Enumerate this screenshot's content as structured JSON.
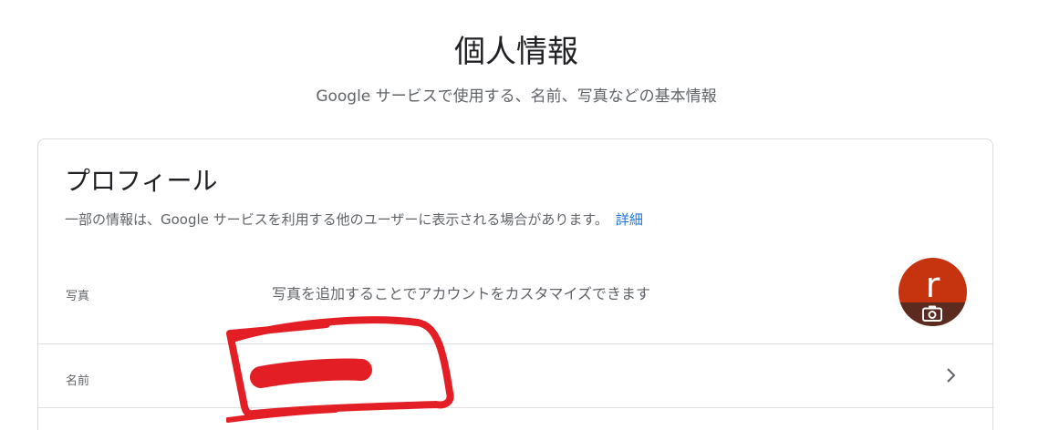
{
  "header": {
    "title": "個人情報",
    "subtitle": "Google サービスで使用する、名前、写真などの基本情報"
  },
  "profile_card": {
    "title": "プロフィール",
    "description": "一部の情報は、Google サービスを利用する他のユーザーに表示される場合があります。",
    "details_link": "詳細",
    "photo_row": {
      "label": "写真",
      "value": "写真を追加することでアカウントをカスタマイズできます",
      "avatar_letter": "r",
      "avatar_color": "#c6330f",
      "camera_icon": "camera-icon"
    },
    "name_row": {
      "label": "名前",
      "value": "",
      "chevron_icon": "chevron-right-icon"
    }
  },
  "colors": {
    "accent_link": "#1a73e8",
    "redaction": "#e31e24"
  }
}
